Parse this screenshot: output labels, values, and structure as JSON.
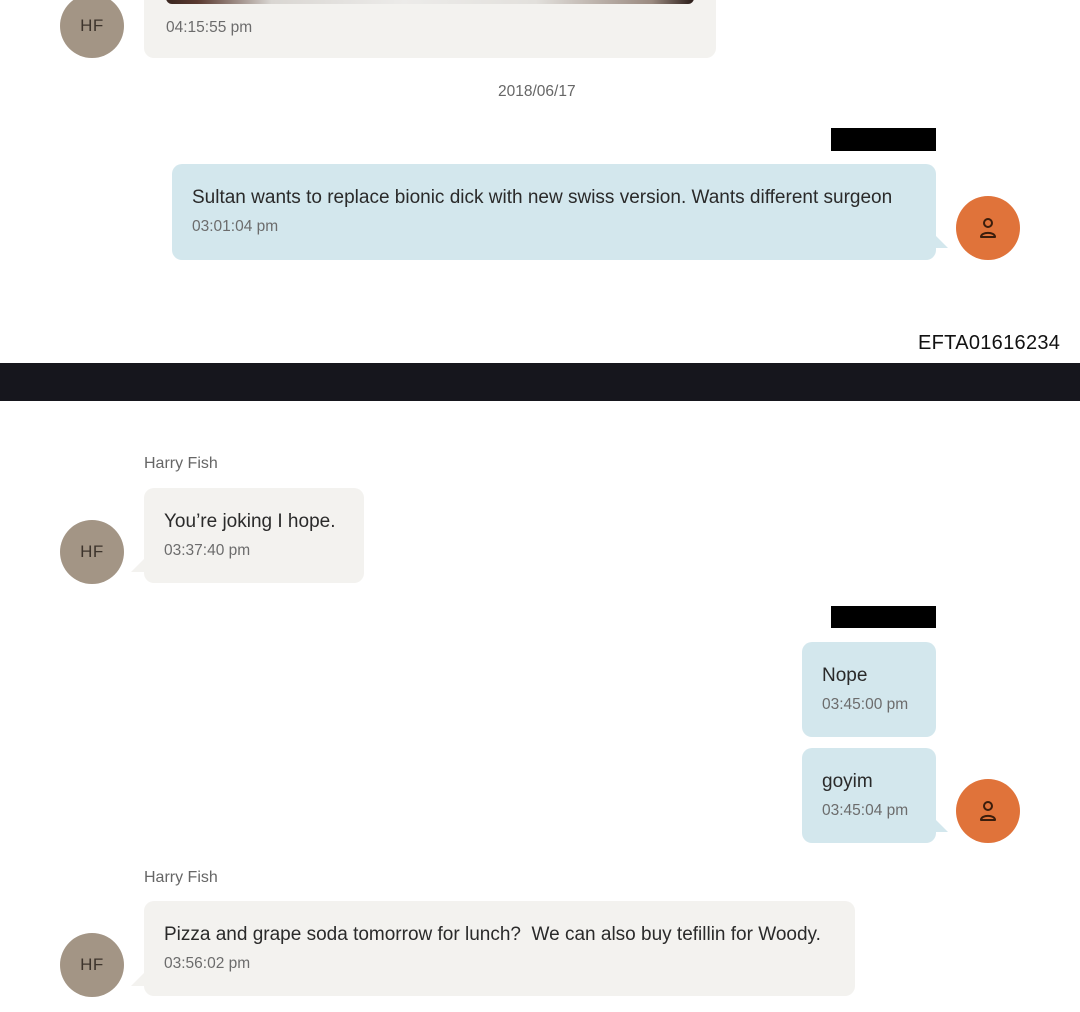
{
  "top": {
    "first_message": {
      "time": "04:15:55 pm",
      "avatar": "HF"
    },
    "date_separator": "2018/06/17",
    "sent_message": {
      "text": "Sultan wants to replace bionic dick with new swiss version. Wants different surgeon",
      "time": "03:01:04 pm"
    },
    "document_id": "EFTA01616234"
  },
  "bottom": {
    "incoming_1": {
      "sender": "Harry Fish",
      "avatar": "HF",
      "text": "You’re joking I hope.",
      "time": "03:37:40 pm"
    },
    "outgoing_1": {
      "text": "Nope",
      "time": "03:45:00 pm"
    },
    "outgoing_2": {
      "text": "goyim",
      "time": "03:45:04 pm"
    },
    "incoming_2": {
      "sender": "Harry Fish",
      "avatar": "HF",
      "text": "Pizza and grape soda tomorrow for lunch?  We can also buy tefillin for Woody.",
      "time": "03:56:02 pm"
    }
  },
  "colors": {
    "incoming_bubble": "#f3f2ef",
    "outgoing_bubble": "#d3e7ed",
    "avatar_hf": "#a39585",
    "avatar_me": "#e0733a",
    "divider_bar": "#16161d"
  },
  "icons": {
    "user_avatar": "person-outline-icon"
  }
}
